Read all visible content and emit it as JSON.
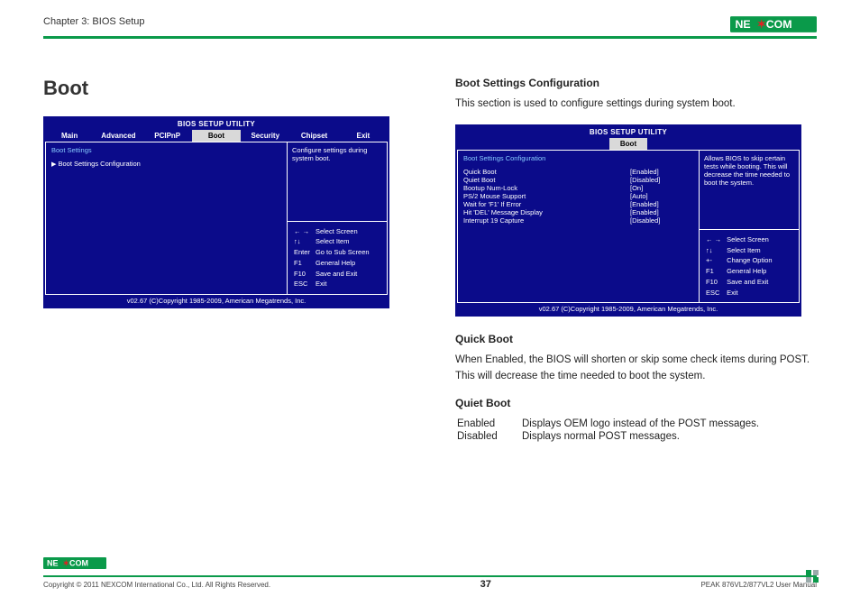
{
  "header": {
    "chapter": "Chapter 3: BIOS Setup",
    "brand": "NEXCOM"
  },
  "left": {
    "title": "Boot",
    "bios1": {
      "title": "BIOS SETUP UTILITY",
      "tabs": [
        "Main",
        "Advanced",
        "PCIPnP",
        "Boot",
        "Security",
        "Chipset",
        "Exit"
      ],
      "active_tab": "Boot",
      "settings_group": "Boot Settings",
      "settings_item": "Boot Settings Configuration",
      "help_top": "Configure settings during system boot.",
      "nav": [
        {
          "k": "← →",
          "v": "Select Screen"
        },
        {
          "k": "↑↓",
          "v": "Select Item"
        },
        {
          "k": "Enter",
          "v": "Go to Sub Screen"
        },
        {
          "k": "F1",
          "v": "General Help"
        },
        {
          "k": "F10",
          "v": "Save and Exit"
        },
        {
          "k": "ESC",
          "v": "Exit"
        }
      ],
      "footer": "v02.67 (C)Copyright 1985-2009, American Megatrends, Inc."
    }
  },
  "right": {
    "h1": "Boot Settings Configuration",
    "p1": "This section is used to configure settings during system boot.",
    "bios2": {
      "title": "BIOS SETUP UTILITY",
      "active_tab": "Boot",
      "group": "Boot Settings Configuration",
      "rows": [
        {
          "label": "Quick Boot",
          "value": "[Enabled]"
        },
        {
          "label": "Quiet Boot",
          "value": "[Disabled]"
        },
        {
          "label": "Bootup Num-Lock",
          "value": "[On]"
        },
        {
          "label": "PS/2 Mouse Support",
          "value": "[Auto]"
        },
        {
          "label": "Wait for 'F1' If Error",
          "value": "[Enabled]"
        },
        {
          "label": "Hit 'DEL' Message Display",
          "value": "[Enabled]"
        },
        {
          "label": "Interrupt 19 Capture",
          "value": "[Disabled]"
        }
      ],
      "help_top": "Allows BIOS to skip certain tests while booting. This will decrease the time needed to boot the system.",
      "nav": [
        {
          "k": "← →",
          "v": "Select Screen"
        },
        {
          "k": "↑↓",
          "v": "Select Item"
        },
        {
          "k": "+-",
          "v": "Change Option"
        },
        {
          "k": "F1",
          "v": "General Help"
        },
        {
          "k": "F10",
          "v": "Save and Exit"
        },
        {
          "k": "ESC",
          "v": "Exit"
        }
      ],
      "footer": "v02.67 (C)Copyright 1985-2009, American Megatrends, Inc."
    },
    "qb_h": "Quick Boot",
    "qb_p": "When Enabled, the BIOS will shorten or skip some check items during POST. This will decrease the time needed to boot the system.",
    "qib_h": "Quiet Boot",
    "qib_rows": [
      {
        "k": "Enabled",
        "v": "Displays OEM logo instead of the POST messages."
      },
      {
        "k": "Disabled",
        "v": "Displays normal POST messages."
      }
    ]
  },
  "footer": {
    "copyright": "Copyright © 2011 NEXCOM International Co., Ltd. All Rights Reserved.",
    "page": "37",
    "manual": "PEAK 876VL2/877VL2 User Manual",
    "brand": "NEXCOM"
  }
}
